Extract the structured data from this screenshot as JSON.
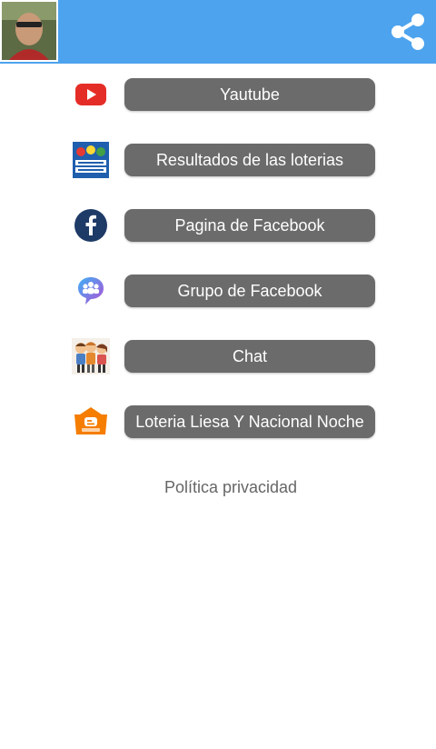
{
  "header": {
    "avatar_icon": "profile-photo",
    "share_icon": "share-icon",
    "bar_color": "#4da3ee"
  },
  "menu": [
    {
      "label": "Yautube",
      "icon": "youtube-icon"
    },
    {
      "label": "Resultados de las loterias",
      "icon": "loteria-dominicana-icon"
    },
    {
      "label": "Pagina de Facebook",
      "icon": "facebook-icon"
    },
    {
      "label": "Grupo de Facebook",
      "icon": "facebook-group-icon"
    },
    {
      "label": "Chat",
      "icon": "chat-people-icon"
    },
    {
      "label": "Loteria Liesa Y Nacional Noche",
      "icon": "blogger-icon"
    }
  ],
  "footer": {
    "privacy_label": "Política privacidad"
  },
  "colors": {
    "button_bg": "#6b6b6b",
    "button_text": "#ffffff"
  }
}
